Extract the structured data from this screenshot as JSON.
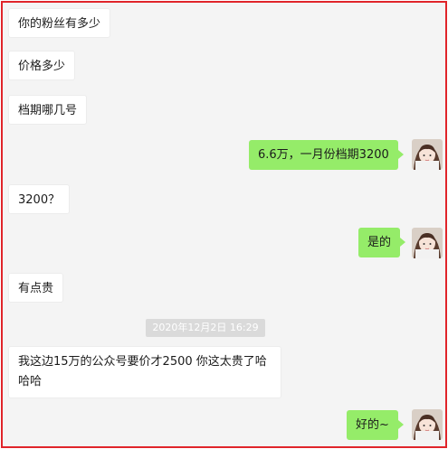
{
  "chat": {
    "messages": [
      {
        "side": "left",
        "text": "你的粉丝有多少"
      },
      {
        "side": "left",
        "text": "价格多少"
      },
      {
        "side": "left",
        "text": "档期哪几号"
      },
      {
        "side": "right",
        "text": "6.6万，一月份档期3200"
      },
      {
        "side": "left",
        "text": "3200？"
      },
      {
        "side": "right",
        "text": "是的"
      },
      {
        "side": "left",
        "text": "有点贵"
      },
      {
        "side": "left",
        "text": "我这边15万的公众号要价才2500  你这太贵了哈哈哈"
      },
      {
        "side": "right",
        "text": "好的~"
      }
    ],
    "timestamp": "2020年12月2日 16:29"
  },
  "colors": {
    "frame_border": "#e0242a",
    "background": "#f4f4f4",
    "left_bubble": "#ffffff",
    "right_bubble": "#95ec69",
    "timestamp_bg": "#dadada"
  },
  "icons": {
    "self_avatar": "girl-avatar-icon"
  }
}
